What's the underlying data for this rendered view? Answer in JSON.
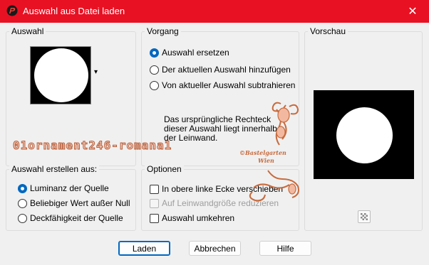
{
  "window": {
    "title": "Auswahl aus Datei laden",
    "close_glyph": "✕",
    "accent_color": "#e81123"
  },
  "auswahl": {
    "legend": "Auswahl",
    "dropdown_glyph": "▾"
  },
  "vorgang": {
    "legend": "Vorgang",
    "options": [
      {
        "label": "Auswahl ersetzen",
        "selected": true
      },
      {
        "label": "Der aktuellen Auswahl hinzufügen",
        "selected": false
      },
      {
        "label": "Von aktueller Auswahl subtrahieren",
        "selected": false
      }
    ],
    "info": "Das ursprüngliche Rechteck dieser Auswahl liegt innerhalb der Leinwand."
  },
  "vorschau": {
    "legend": "Vorschau",
    "zoom_icon": "checker-icon"
  },
  "erstellen": {
    "legend": "Auswahl erstellen aus:",
    "options": [
      {
        "label": "Luminanz der Quelle",
        "selected": true
      },
      {
        "label": "Beliebiger Wert außer Null",
        "selected": false
      },
      {
        "label": "Deckfähigkeit der Quelle",
        "selected": false
      }
    ]
  },
  "optionen": {
    "legend": "Optionen",
    "items": [
      {
        "label": "In obere linke Ecke verschieben",
        "checked": false,
        "disabled": false
      },
      {
        "label": "Auf Leinwandgröße reduzieren",
        "checked": false,
        "disabled": true
      },
      {
        "label": "Auswahl umkehren",
        "checked": false,
        "disabled": false
      }
    ]
  },
  "buttons": {
    "load": "Laden",
    "cancel": "Abbrechen",
    "help": "Hilfe"
  },
  "overlay": {
    "filename_watermark": "01ornament246-romana1",
    "logo_line1": "©Bastelgarten",
    "logo_line2": "Wien"
  }
}
